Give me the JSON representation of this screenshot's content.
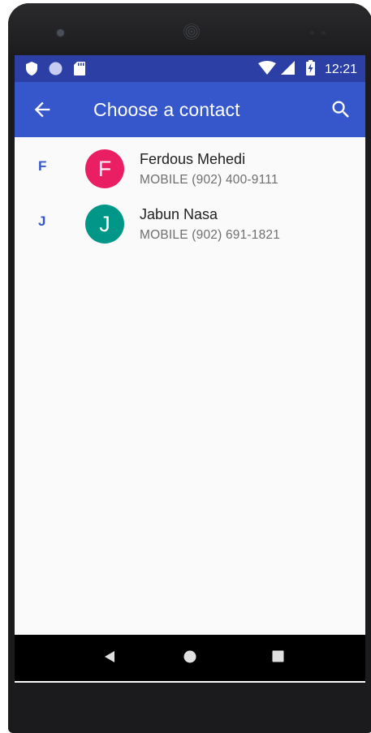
{
  "status_bar": {
    "time": "12:21",
    "left_icons": [
      "shield-icon",
      "circle-icon",
      "sd-card-icon"
    ],
    "right_icons": [
      "wifi-icon",
      "signal-icon",
      "battery-charging-icon"
    ]
  },
  "app_bar": {
    "title": "Choose a contact",
    "back_icon": "arrow-back-icon",
    "search_icon": "search-icon",
    "background_color": "#3557cb",
    "status_bar_color": "#2b3fa5"
  },
  "contacts": [
    {
      "section": "F",
      "initial": "F",
      "name": "Ferdous Mehedi",
      "phone": "MOBILE (902) 400-9111",
      "avatar_color": "#e91e63"
    },
    {
      "section": "J",
      "initial": "J",
      "name": "Jabun Nasa",
      "phone": "MOBILE (902) 691-1821",
      "avatar_color": "#009688"
    }
  ],
  "nav_bar": {
    "back": "nav-back-icon",
    "home": "nav-home-icon",
    "recents": "nav-recents-icon"
  }
}
